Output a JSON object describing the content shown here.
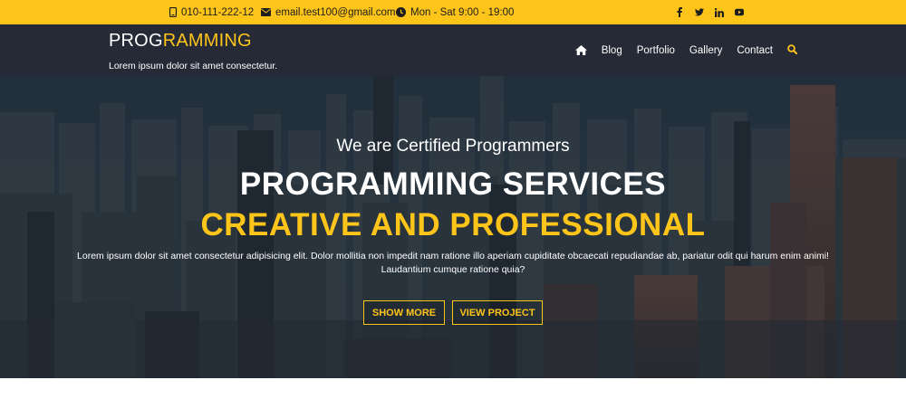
{
  "topbar": {
    "phone": "010-111-222-12",
    "email": "email.test100@gmail.com",
    "hours": "Mon - Sat 9:00 - 19:00",
    "social_icons": [
      "facebook-icon",
      "twitter-icon",
      "linkedin-icon",
      "youtube-icon"
    ],
    "background": "#fdc419"
  },
  "header": {
    "brand_part1": "PROG",
    "brand_part2": "RAMMING",
    "tagline": "Lorem ipsum dolor sit amet consectetur.",
    "nav": {
      "home_icon": "home-icon",
      "items": [
        "Blog",
        "Portfolio",
        "Gallery",
        "Contact"
      ],
      "search_icon": "search-icon"
    },
    "background": "#262a37"
  },
  "hero": {
    "subtitle": "We are Certified Programmers",
    "title_line1": "PROGRAMMING SERVICES",
    "title_line2": "CREATIVE AND PROFESSIONAL",
    "text": "Lorem ipsum dolor sit amet consectetur adipisicing elit. Dolor mollitia non impedit nam ratione illo aperiam cupiditate obcaecati repudiandae ab, pariatur odit qui harum enim animi! Laudantium cumque ratione quia?",
    "button_primary": "SHOW MORE",
    "button_secondary": "VIEW PROJECT",
    "accent": "#fdc419"
  }
}
